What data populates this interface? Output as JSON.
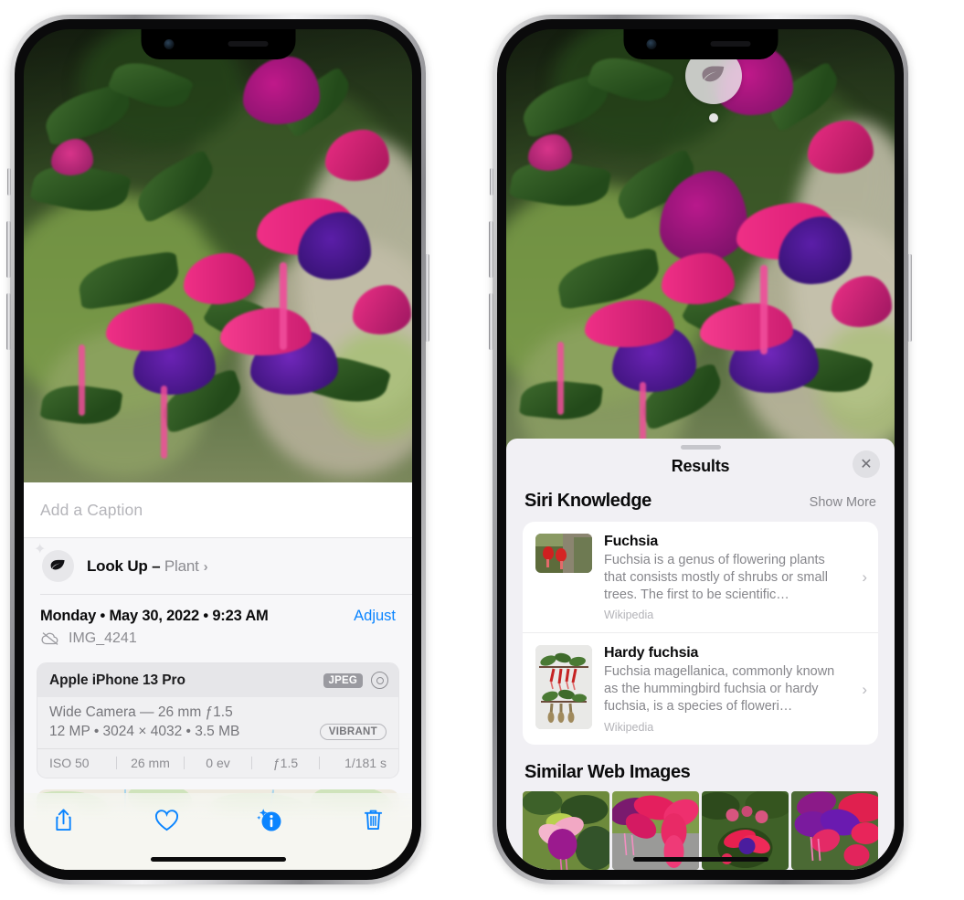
{
  "left_phone": {
    "photo": {
      "alt": "fuchsia-flowers-photo"
    },
    "caption_field": {
      "placeholder": "Add a Caption",
      "value": ""
    },
    "look_up": {
      "icon": "leaf-icon",
      "sparkle": "sparkle-icon",
      "label": "Look Up",
      "dash": " – ",
      "subject": "Plant",
      "chevron": "›"
    },
    "meta": {
      "date": "Monday • May 30, 2022 • 9:23 AM",
      "adjust_label": "Adjust",
      "cloud_icon": "cloud-slash-icon",
      "filename": "IMG_4241"
    },
    "exif": {
      "device": "Apple iPhone 13 Pro",
      "format_tag": "JPEG",
      "raw_icon": "aperture-icon",
      "lens_line": "Wide Camera — 26 mm ƒ1.5",
      "size_line": "12 MP • 3024 × 4032 • 3.5 MB",
      "profile_tag": "VIBRANT",
      "stats": [
        "ISO 50",
        "26 mm",
        "0 ev",
        "ƒ1.5",
        "1/181 s"
      ]
    },
    "map": {
      "name": "photo-location-map"
    },
    "toolbar": [
      {
        "name": "share-button",
        "icon": "share-icon"
      },
      {
        "name": "favorite-button",
        "icon": "heart-icon"
      },
      {
        "name": "info-button",
        "icon": "info-sparkle-icon"
      },
      {
        "name": "delete-button",
        "icon": "trash-icon"
      }
    ]
  },
  "right_phone": {
    "visual_lookup_badge": {
      "icon": "leaf-icon"
    },
    "results": {
      "title": "Results",
      "close_label": "✕",
      "sections": [
        {
          "title": "Siri Knowledge",
          "action": "Show More",
          "items": [
            {
              "title": "Fuchsia",
              "description": "Fuchsia is a genus of flowering plants that consists mostly of shrubs or small trees. The first to be scientific…",
              "source": "Wikipedia",
              "chevron": "›"
            },
            {
              "title": "Hardy fuchsia",
              "description": "Fuchsia magellanica, commonly known as the hummingbird fuchsia or hardy fuchsia, is a species of floweri…",
              "source": "Wikipedia",
              "chevron": "›"
            }
          ]
        },
        {
          "title": "Similar Web Images",
          "images": [
            "fuchsia-web-image-1",
            "fuchsia-web-image-2",
            "fuchsia-web-image-3",
            "fuchsia-web-image-4"
          ]
        }
      ]
    }
  },
  "colors": {
    "accent_blue": "#0a84ff",
    "sheet_bg": "#f7f7f9",
    "results_bg": "#f1f0f4",
    "secondary_text": "#86868b"
  }
}
